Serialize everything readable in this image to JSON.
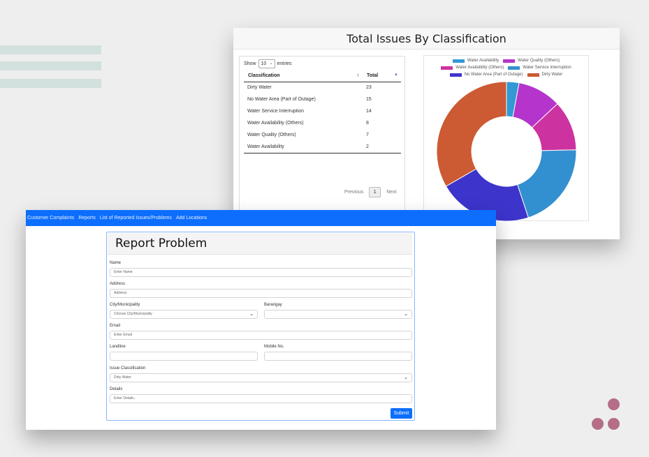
{
  "dashboard": {
    "title": "Total Issues By Classification",
    "show_label": "Show",
    "entries_value": "10",
    "entries_label": "entries",
    "columns": [
      "Classification",
      "Total"
    ],
    "rows": [
      {
        "classification": "Dirty Water",
        "total": "23"
      },
      {
        "classification": "No Water Area (Part of Outage)",
        "total": "15"
      },
      {
        "classification": "Water Service Interruption",
        "total": "14"
      },
      {
        "classification": "Water Availability (Others)",
        "total": "8"
      },
      {
        "classification": "Water Quality (Others)",
        "total": "7"
      },
      {
        "classification": "Water Availability",
        "total": "2"
      }
    ],
    "pagination": {
      "previous": "Previous",
      "page": "1",
      "next": "Next"
    }
  },
  "chart_data": {
    "type": "pie",
    "donut": true,
    "categories": [
      "Water Availability",
      "Water Quality (Others)",
      "Water Availability (Others)",
      "Water Service Interruption",
      "No Water Area (Part of Outage)",
      "Dirty Water"
    ],
    "values": [
      2,
      7,
      8,
      14,
      15,
      23
    ],
    "colors": [
      "#3399d4",
      "#b534cc",
      "#cc33a0",
      "#3390d0",
      "#3d34cc",
      "#cc5a33"
    ],
    "legend_position": "top"
  },
  "nav": {
    "items": [
      "Customer Complaints",
      "Reports",
      "List of Reported Issues/Problems",
      "Add Locations"
    ]
  },
  "form": {
    "title": "Report Problem",
    "name_label": "Name",
    "name_placeholder": "Enter Name",
    "address_label": "Address",
    "address_placeholder": "Address",
    "city_label": "City/Municipality",
    "city_value": "Choose City/Municipality",
    "barangay_label": "Barangay",
    "barangay_value": "",
    "email_label": "Email",
    "email_placeholder": "Enter Email",
    "landline_label": "Landline",
    "mobile_label": "Mobile No.",
    "issue_label": "Issue Classification",
    "issue_value": "Dirty Water",
    "details_label": "Details",
    "details_placeholder": "Enter Details..",
    "submit_label": "Submit"
  }
}
